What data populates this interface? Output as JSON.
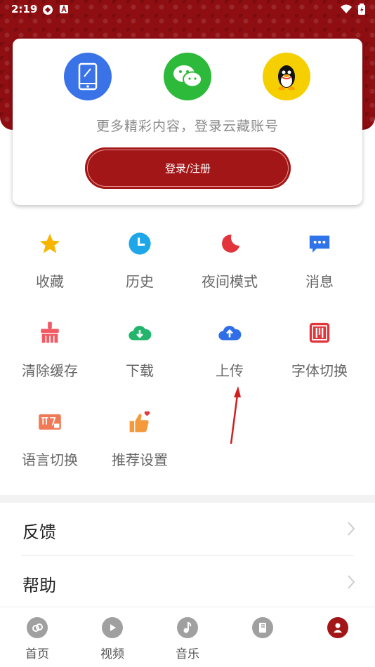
{
  "status_bar": {
    "time": "2:19"
  },
  "login": {
    "prompt": "更多精彩内容，登录云藏账号",
    "button_label": "登录/注册",
    "options": [
      {
        "icon": "phone-icon",
        "color": "#3a73e8"
      },
      {
        "icon": "wechat-icon",
        "color": "#2dba3a"
      },
      {
        "icon": "qq-icon",
        "color": "#f6cf00"
      }
    ]
  },
  "features": [
    {
      "label": "收藏",
      "icon": "star-icon",
      "color": "#f7b500"
    },
    {
      "label": "历史",
      "icon": "clock-icon",
      "color": "#1ea7e8"
    },
    {
      "label": "夜间模式",
      "icon": "moon-icon",
      "color": "#e2343a"
    },
    {
      "label": "消息",
      "icon": "message-icon",
      "color": "#2f74e8"
    },
    {
      "label": "清除缓存",
      "icon": "broom-icon",
      "color": "#ef5b64"
    },
    {
      "label": "下载",
      "icon": "cloud-download-icon",
      "color": "#22b56b"
    },
    {
      "label": "上传",
      "icon": "cloud-upload-icon",
      "color": "#2f6ee8"
    },
    {
      "label": "字体切换",
      "icon": "font-icon",
      "color": "#e0353b"
    },
    {
      "label": "语言切换",
      "icon": "language-icon",
      "color": "#f07a56"
    },
    {
      "label": "推荐设置",
      "icon": "thumbs-up-icon",
      "color": "#f49a3c"
    }
  ],
  "list": [
    {
      "label": "反馈"
    },
    {
      "label": "帮助"
    }
  ],
  "tabs": [
    {
      "label": "首页",
      "icon": "home-icon"
    },
    {
      "label": "视频",
      "icon": "play-icon"
    },
    {
      "label": "音乐",
      "icon": "music-icon"
    },
    {
      "label": "",
      "icon": "book-icon"
    },
    {
      "label": "",
      "icon": "profile-icon"
    }
  ],
  "colors": {
    "brand": "#a31618",
    "header": "#8e0e12"
  }
}
